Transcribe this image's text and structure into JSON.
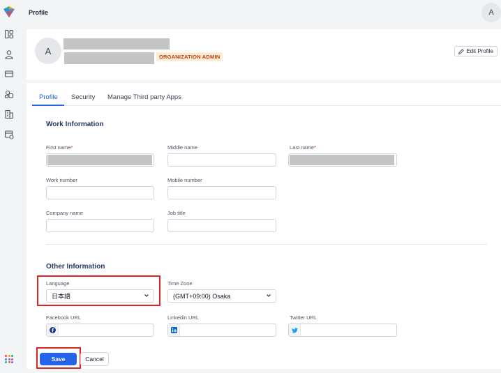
{
  "topbar": {
    "title": "Profile",
    "avatar_initial": "A"
  },
  "header": {
    "avatar_initial": "A",
    "role_badge": "ORGANIZATION ADMIN",
    "edit_label": "Edit Profile"
  },
  "tabs": [
    {
      "label": "Profile",
      "active": true
    },
    {
      "label": "Security",
      "active": false
    },
    {
      "label": "Manage Third party Apps",
      "active": false
    }
  ],
  "work": {
    "title": "Work Information",
    "first_name_label": "First name",
    "middle_name_label": "Middle name",
    "last_name_label": "Last name",
    "work_number_label": "Work number",
    "mobile_number_label": "Mobile number",
    "company_name_label": "Company name",
    "job_title_label": "Job title",
    "required_mark": "*"
  },
  "other": {
    "title": "Other Information",
    "language_label": "Language",
    "language_value": "日本語",
    "timezone_label": "Time Zone",
    "timezone_value": "(GMT+09:00) Osaka",
    "facebook_label": "Facebook URL",
    "linkedin_label": "Linkedin URL",
    "twitter_label": "Twitter URL"
  },
  "actions": {
    "save_label": "Save",
    "cancel_label": "Cancel"
  },
  "colors": {
    "accent": "#2563eb",
    "highlight": "#dc2626",
    "badge_bg": "#fdecd8",
    "badge_fg": "#c2410c"
  },
  "icons": {
    "sidebar": [
      "dashboard-icon",
      "user-icon",
      "card-icon",
      "shapes-icon",
      "building-icon",
      "calendar-card-icon"
    ],
    "apps": "apps-grid-icon",
    "edit": "pencil-icon",
    "select": "chevron-down-icon",
    "social": [
      "facebook-icon",
      "linkedin-icon",
      "twitter-icon"
    ]
  }
}
